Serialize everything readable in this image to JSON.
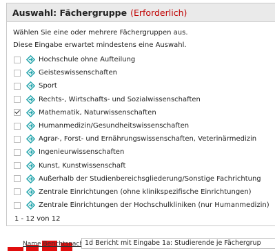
{
  "panel": {
    "title": "Auswahl: Fächergruppe",
    "required": "(Erforderlich)",
    "description": "Wählen Sie eine oder mehrere Fächergruppen aus.",
    "hint": "Diese Eingabe erwartet mindestens eine Auswahl.",
    "count": "1 - 12 von 12"
  },
  "options": [
    {
      "label": "Hochschule ohne Aufteilung",
      "checked": false
    },
    {
      "label": "Geisteswissenschaften",
      "checked": false
    },
    {
      "label": "Sport",
      "checked": false
    },
    {
      "label": "Rechts-, Wirtschafts- und Sozialwissenschaften",
      "checked": false
    },
    {
      "label": "Mathematik, Naturwissenschaften",
      "checked": true
    },
    {
      "label": "Humanmedizin/Gesundheitswissenschaften",
      "checked": false
    },
    {
      "label": "Agrar-, Forst- und Ernährungswissenschaften, Veterinärmedizin",
      "checked": false
    },
    {
      "label": "Ingenieurwissenschaften",
      "checked": false
    },
    {
      "label": "Kunst, Kunstwissenschaft",
      "checked": false
    },
    {
      "label": "Außerhalb der Studienbereichsgliederung/Sonstige Fachrichtung",
      "checked": false
    },
    {
      "label": "Zentrale Einrichtungen (ohne klinikspezifische Einrichtungen)",
      "checked": false
    },
    {
      "label": "Zentrale Einrichtungen der Hochschulkliniken (nur Humanmedizin)",
      "checked": false
    }
  ],
  "report": {
    "label": "Name Berichtsnachricht",
    "value": "1d Bericht mit Eingabe 1a: Studierende je Fächergrup"
  },
  "colors": {
    "required": "#c00000",
    "icon": "#1aa0a8",
    "annotation": "#e10e0e"
  },
  "icons": {
    "item": "diamond-icon"
  }
}
